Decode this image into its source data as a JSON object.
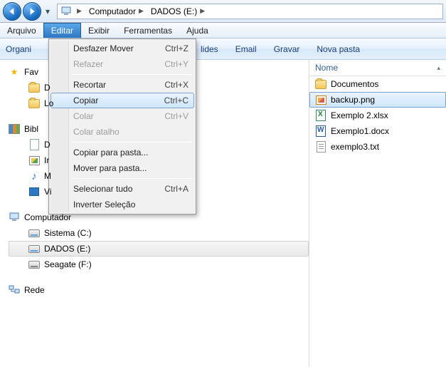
{
  "nav": {
    "crumbs": [
      "Computador",
      "DADOS (E:)"
    ]
  },
  "menubar": {
    "items": [
      "Arquivo",
      "Editar",
      "Exibir",
      "Ferramentas",
      "Ajuda"
    ],
    "active_index": 1
  },
  "toolbar": {
    "organize_partial": "Organiz",
    "slides_partial": "lides",
    "email": "Email",
    "gravar": "Gravar",
    "nova_pasta": "Nova pasta"
  },
  "edit_menu": {
    "items": [
      {
        "label": "Desfazer Mover",
        "shortcut": "Ctrl+Z",
        "enabled": true
      },
      {
        "label": "Refazer",
        "shortcut": "Ctrl+Y",
        "enabled": false
      },
      {
        "sep": true
      },
      {
        "label": "Recortar",
        "shortcut": "Ctrl+X",
        "enabled": true
      },
      {
        "label": "Copiar",
        "shortcut": "Ctrl+C",
        "enabled": true,
        "hover": true
      },
      {
        "label": "Colar",
        "shortcut": "Ctrl+V",
        "enabled": false
      },
      {
        "label": "Colar atalho",
        "shortcut": "",
        "enabled": false
      },
      {
        "sep": true
      },
      {
        "label": "Copiar para pasta...",
        "shortcut": "",
        "enabled": true
      },
      {
        "label": "Mover para pasta...",
        "shortcut": "",
        "enabled": true
      },
      {
        "sep": true
      },
      {
        "label": "Selecionar tudo",
        "shortcut": "Ctrl+A",
        "enabled": true
      },
      {
        "label": "Inverter Seleção",
        "shortcut": "",
        "enabled": true
      }
    ]
  },
  "tree": {
    "favorites_label_partial": "Fav",
    "favorites": [
      {
        "label_partial": "D",
        "icon": "folder"
      },
      {
        "label_partial": "Lo",
        "icon": "folder"
      }
    ],
    "libraries_label_partial": "Bibl",
    "libraries": [
      {
        "label_partial": "D",
        "icon": "doc"
      },
      {
        "label_partial": "Ir",
        "icon": "img"
      },
      {
        "label_partial": "M",
        "icon": "music"
      },
      {
        "label_partial": "Vi",
        "icon": "vid"
      }
    ],
    "computer_label": "Computador",
    "drives": [
      {
        "label": "Sistema (C:)",
        "icon": "drive",
        "selected": false
      },
      {
        "label": "DADOS (E:)",
        "icon": "drive",
        "selected": true
      },
      {
        "label": "Seagate (F:)",
        "icon": "drive-ext",
        "selected": false
      }
    ],
    "network_label": "Rede"
  },
  "list": {
    "column_header": "Nome",
    "files": [
      {
        "name": "Documentos",
        "icon": "folder",
        "selected": false
      },
      {
        "name": "backup.png",
        "icon": "png",
        "selected": true
      },
      {
        "name": "Exemplo 2.xlsx",
        "icon": "xlsx",
        "selected": false
      },
      {
        "name": "Exemplo1.docx",
        "icon": "docx",
        "selected": false
      },
      {
        "name": "exemplo3.txt",
        "icon": "txt",
        "selected": false
      }
    ]
  }
}
